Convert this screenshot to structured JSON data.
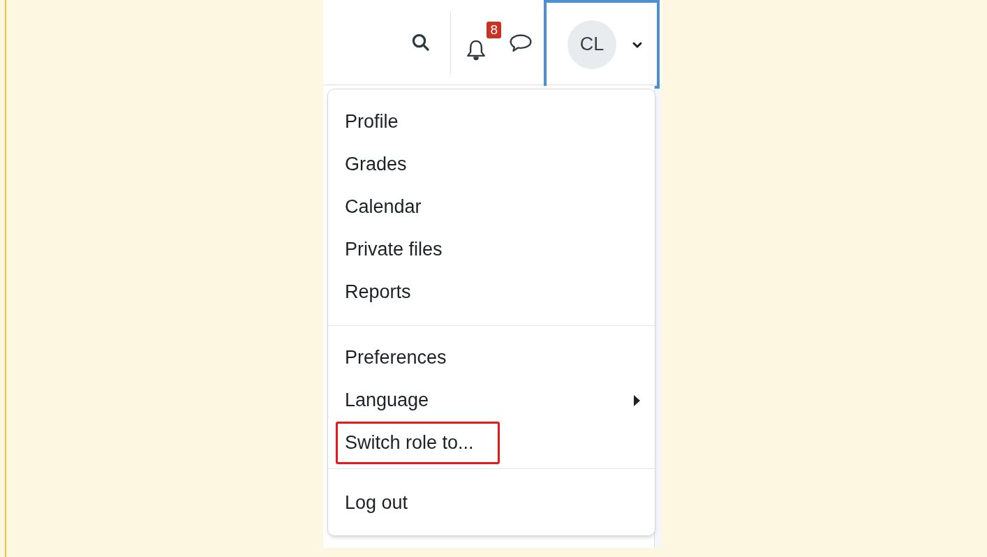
{
  "header": {
    "notifications": {
      "count": "8"
    },
    "user_menu": {
      "initials": "CL",
      "highlighted": true
    }
  },
  "menu": {
    "groups": [
      [
        {
          "label": "Profile",
          "submenu": false,
          "highlighted": false
        },
        {
          "label": "Grades",
          "submenu": false,
          "highlighted": false
        },
        {
          "label": "Calendar",
          "submenu": false,
          "highlighted": false
        },
        {
          "label": "Private files",
          "submenu": false,
          "highlighted": false
        },
        {
          "label": "Reports",
          "submenu": false,
          "highlighted": false
        }
      ],
      [
        {
          "label": "Preferences",
          "submenu": false,
          "highlighted": false
        },
        {
          "label": "Language",
          "submenu": true,
          "highlighted": false
        },
        {
          "label": "Switch role to...",
          "submenu": false,
          "highlighted": true
        }
      ],
      [
        {
          "label": "Log out",
          "submenu": false,
          "highlighted": false
        }
      ]
    ]
  }
}
